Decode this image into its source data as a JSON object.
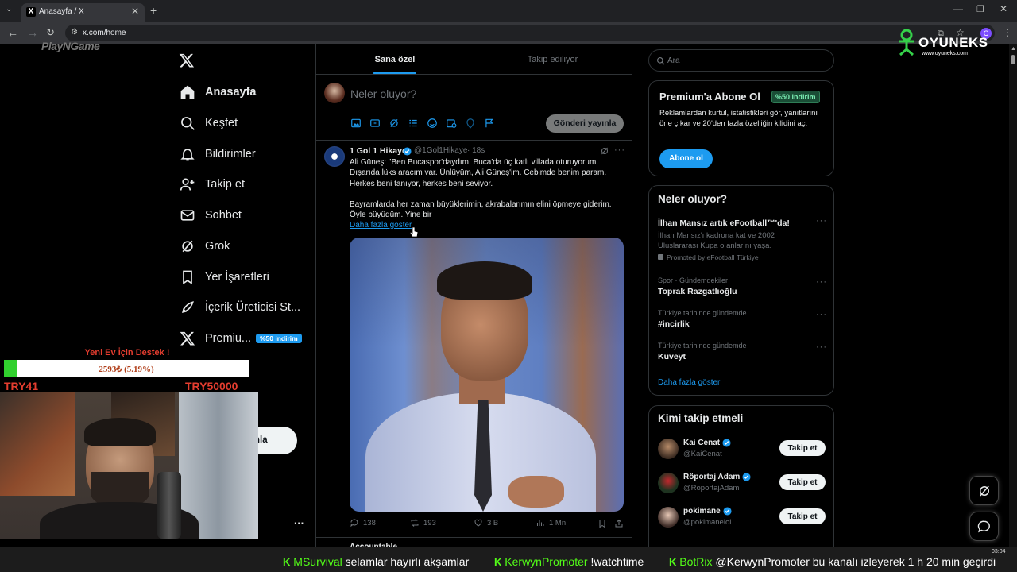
{
  "browser": {
    "tab_title": "Anasayfa / X",
    "url": "x.com/home",
    "profile_initial": "C"
  },
  "overlay": {
    "brand_logo": "OYUNEKS",
    "brand_url": "www.oyuneks.com",
    "watermark": "PlayNGame",
    "donation_title": "Yeni Ev İçin Destek !",
    "donation_progress_text": "2593₺ (5.19%)",
    "donation_progress": 0.0519,
    "donation_min": "TRY41",
    "donation_max": "TRY50000"
  },
  "sidebar": {
    "items": [
      {
        "label": "Anasayfa",
        "icon": "home-icon"
      },
      {
        "label": "Keşfet",
        "icon": "search-icon"
      },
      {
        "label": "Bildirimler",
        "icon": "bell-icon"
      },
      {
        "label": "Takip et",
        "icon": "follow-icon"
      },
      {
        "label": "Sohbet",
        "icon": "mail-icon"
      },
      {
        "label": "Grok",
        "icon": "grok-icon"
      },
      {
        "label": "Yer İşaretleri",
        "icon": "bookmark-icon"
      },
      {
        "label": "İçerik Üreticisi St...",
        "icon": "rocket-icon"
      },
      {
        "label": "Premiu...",
        "icon": "x-logo-icon"
      }
    ],
    "premium_badge": "%50 indirim",
    "post_button_partial": "nla",
    "more": "···"
  },
  "feed": {
    "tabs": [
      "Sana özel",
      "Takip ediliyor"
    ],
    "composer_placeholder": "Neler oluyor?",
    "composer_button": "Gönderi yayınla",
    "tweet": {
      "author": "1 Gol 1 Hikaye",
      "handle": "@1Gol1Hikaye",
      "time": "· 18s",
      "text1": "Ali Güneş: \"Ben Bucaspor'daydım. Buca'da üç katlı villada oturuyorum. Dışarıda lüks aracım var. Ünlüyüm, Ali Güneş'im. Cebimde benim param. Herkes beni tanıyor, herkes beni seviyor.",
      "text2": "Bayramlarda her zaman büyüklerimin, akrabalarımın elini öpmeye giderim. Öyle büyüdüm. Yine bir",
      "show_more": "Daha fazla göster",
      "replies": "138",
      "retweets": "193",
      "likes": "3 B",
      "views": "1 Mn"
    },
    "next_author_partial": "Accountable"
  },
  "right": {
    "search_placeholder": "Ara",
    "premium": {
      "title": "Premium'a Abone Ol",
      "badge": "%50 indirim",
      "text": "Reklamlardan kurtul, istatistikleri gör, yanıtlarını öne çıkar ve 20'den fazla özelliğin kilidini aç.",
      "button": "Abone ol"
    },
    "trends": {
      "title": "Neler oluyor?",
      "promo_title": "İlhan Mansız artık eFootball™'da!",
      "promo_text": "İlhan Mansız'ı kadrona kat ve 2002 Uluslararası Kupa o anlarını yaşa.",
      "promo_by": "Promoted by eFootball Türkiye",
      "items": [
        {
          "meta": "Spor · Gündemdekiler",
          "name": "Toprak Razgatlıoğlu"
        },
        {
          "meta": "Türkiye tarihinde gündemde",
          "name": "#incirlik"
        },
        {
          "meta": "Türkiye tarihinde gündemde",
          "name": "Kuveyt"
        }
      ],
      "show_more": "Daha fazla göster"
    },
    "follow": {
      "title": "Kimi takip etmeli",
      "button": "Takip et",
      "users": [
        {
          "name": "Kai Cenat",
          "handle": "@KaiCenat"
        },
        {
          "name": "Röportaj Adam",
          "handle": "@RoportajAdam"
        },
        {
          "name": "pokimane",
          "handle": "@pokimanelol"
        }
      ]
    }
  },
  "chat": {
    "m1_user": "MSurvival",
    "m1_text": "selamlar hayırlı akşamlar",
    "m2_user": "KerwynPromoter",
    "m2_text": "!watchtime",
    "m3_user": "BotRix",
    "m3_text": "@KerwynPromoter bu kanalı izleyerek 1 h 20 min geçirdi"
  },
  "taskbar": {
    "clock": "03:04"
  },
  "colors": {
    "accent": "#1d9bf0",
    "kick_green": "#53fc18",
    "bg": "#000000"
  }
}
